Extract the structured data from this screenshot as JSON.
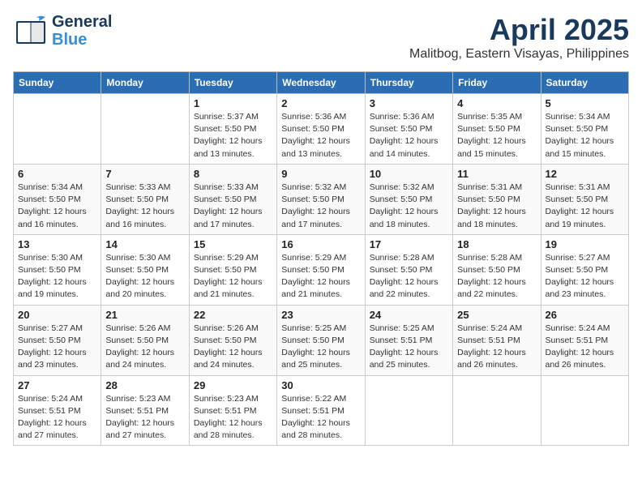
{
  "header": {
    "logo_line1": "General",
    "logo_line2": "Blue",
    "title": "April 2025",
    "subtitle": "Malitbog, Eastern Visayas, Philippines"
  },
  "days_of_week": [
    "Sunday",
    "Monday",
    "Tuesday",
    "Wednesday",
    "Thursday",
    "Friday",
    "Saturday"
  ],
  "weeks": [
    [
      {
        "num": "",
        "detail": ""
      },
      {
        "num": "",
        "detail": ""
      },
      {
        "num": "1",
        "detail": "Sunrise: 5:37 AM\nSunset: 5:50 PM\nDaylight: 12 hours and 13 minutes."
      },
      {
        "num": "2",
        "detail": "Sunrise: 5:36 AM\nSunset: 5:50 PM\nDaylight: 12 hours and 13 minutes."
      },
      {
        "num": "3",
        "detail": "Sunrise: 5:36 AM\nSunset: 5:50 PM\nDaylight: 12 hours and 14 minutes."
      },
      {
        "num": "4",
        "detail": "Sunrise: 5:35 AM\nSunset: 5:50 PM\nDaylight: 12 hours and 15 minutes."
      },
      {
        "num": "5",
        "detail": "Sunrise: 5:34 AM\nSunset: 5:50 PM\nDaylight: 12 hours and 15 minutes."
      }
    ],
    [
      {
        "num": "6",
        "detail": "Sunrise: 5:34 AM\nSunset: 5:50 PM\nDaylight: 12 hours and 16 minutes."
      },
      {
        "num": "7",
        "detail": "Sunrise: 5:33 AM\nSunset: 5:50 PM\nDaylight: 12 hours and 16 minutes."
      },
      {
        "num": "8",
        "detail": "Sunrise: 5:33 AM\nSunset: 5:50 PM\nDaylight: 12 hours and 17 minutes."
      },
      {
        "num": "9",
        "detail": "Sunrise: 5:32 AM\nSunset: 5:50 PM\nDaylight: 12 hours and 17 minutes."
      },
      {
        "num": "10",
        "detail": "Sunrise: 5:32 AM\nSunset: 5:50 PM\nDaylight: 12 hours and 18 minutes."
      },
      {
        "num": "11",
        "detail": "Sunrise: 5:31 AM\nSunset: 5:50 PM\nDaylight: 12 hours and 18 minutes."
      },
      {
        "num": "12",
        "detail": "Sunrise: 5:31 AM\nSunset: 5:50 PM\nDaylight: 12 hours and 19 minutes."
      }
    ],
    [
      {
        "num": "13",
        "detail": "Sunrise: 5:30 AM\nSunset: 5:50 PM\nDaylight: 12 hours and 19 minutes."
      },
      {
        "num": "14",
        "detail": "Sunrise: 5:30 AM\nSunset: 5:50 PM\nDaylight: 12 hours and 20 minutes."
      },
      {
        "num": "15",
        "detail": "Sunrise: 5:29 AM\nSunset: 5:50 PM\nDaylight: 12 hours and 21 minutes."
      },
      {
        "num": "16",
        "detail": "Sunrise: 5:29 AM\nSunset: 5:50 PM\nDaylight: 12 hours and 21 minutes."
      },
      {
        "num": "17",
        "detail": "Sunrise: 5:28 AM\nSunset: 5:50 PM\nDaylight: 12 hours and 22 minutes."
      },
      {
        "num": "18",
        "detail": "Sunrise: 5:28 AM\nSunset: 5:50 PM\nDaylight: 12 hours and 22 minutes."
      },
      {
        "num": "19",
        "detail": "Sunrise: 5:27 AM\nSunset: 5:50 PM\nDaylight: 12 hours and 23 minutes."
      }
    ],
    [
      {
        "num": "20",
        "detail": "Sunrise: 5:27 AM\nSunset: 5:50 PM\nDaylight: 12 hours and 23 minutes."
      },
      {
        "num": "21",
        "detail": "Sunrise: 5:26 AM\nSunset: 5:50 PM\nDaylight: 12 hours and 24 minutes."
      },
      {
        "num": "22",
        "detail": "Sunrise: 5:26 AM\nSunset: 5:50 PM\nDaylight: 12 hours and 24 minutes."
      },
      {
        "num": "23",
        "detail": "Sunrise: 5:25 AM\nSunset: 5:50 PM\nDaylight: 12 hours and 25 minutes."
      },
      {
        "num": "24",
        "detail": "Sunrise: 5:25 AM\nSunset: 5:51 PM\nDaylight: 12 hours and 25 minutes."
      },
      {
        "num": "25",
        "detail": "Sunrise: 5:24 AM\nSunset: 5:51 PM\nDaylight: 12 hours and 26 minutes."
      },
      {
        "num": "26",
        "detail": "Sunrise: 5:24 AM\nSunset: 5:51 PM\nDaylight: 12 hours and 26 minutes."
      }
    ],
    [
      {
        "num": "27",
        "detail": "Sunrise: 5:24 AM\nSunset: 5:51 PM\nDaylight: 12 hours and 27 minutes."
      },
      {
        "num": "28",
        "detail": "Sunrise: 5:23 AM\nSunset: 5:51 PM\nDaylight: 12 hours and 27 minutes."
      },
      {
        "num": "29",
        "detail": "Sunrise: 5:23 AM\nSunset: 5:51 PM\nDaylight: 12 hours and 28 minutes."
      },
      {
        "num": "30",
        "detail": "Sunrise: 5:22 AM\nSunset: 5:51 PM\nDaylight: 12 hours and 28 minutes."
      },
      {
        "num": "",
        "detail": ""
      },
      {
        "num": "",
        "detail": ""
      },
      {
        "num": "",
        "detail": ""
      }
    ]
  ]
}
